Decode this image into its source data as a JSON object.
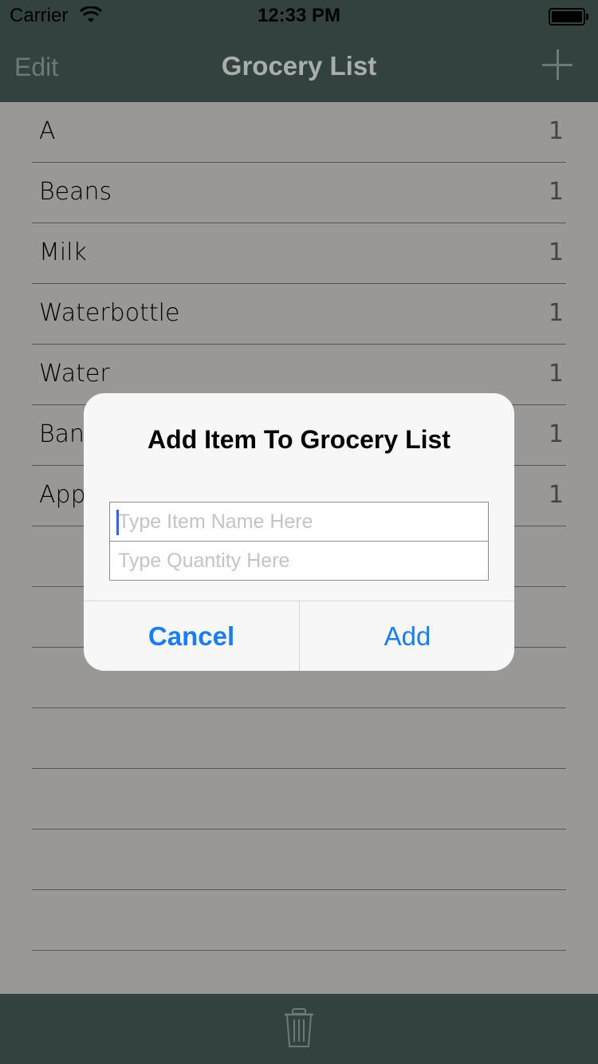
{
  "status_bar": {
    "carrier": "Carrier",
    "time": "12:33 PM"
  },
  "nav": {
    "edit_label": "Edit",
    "title": "Grocery List",
    "add_icon": "plus-icon"
  },
  "list": {
    "items": [
      {
        "name": "A",
        "qty": "1"
      },
      {
        "name": "Beans",
        "qty": "1"
      },
      {
        "name": "Milk",
        "qty": "1"
      },
      {
        "name": "Waterbottle",
        "qty": "1"
      },
      {
        "name": "Water",
        "qty": "1"
      },
      {
        "name": "Ban",
        "qty": "1"
      },
      {
        "name": "App",
        "qty": "1"
      }
    ],
    "empty_rows": 7
  },
  "toolbar": {
    "trash_icon": "trash-icon"
  },
  "alert": {
    "title": "Add Item To Grocery List",
    "item_placeholder": "Type Item Name Here",
    "item_value": "",
    "quantity_placeholder": "Type Quantity Here",
    "quantity_value": "",
    "cancel_label": "Cancel",
    "add_label": "Add"
  },
  "colors": {
    "bar": "#34423f",
    "list_bg": "#999896",
    "accent": "#1a7ef0"
  }
}
